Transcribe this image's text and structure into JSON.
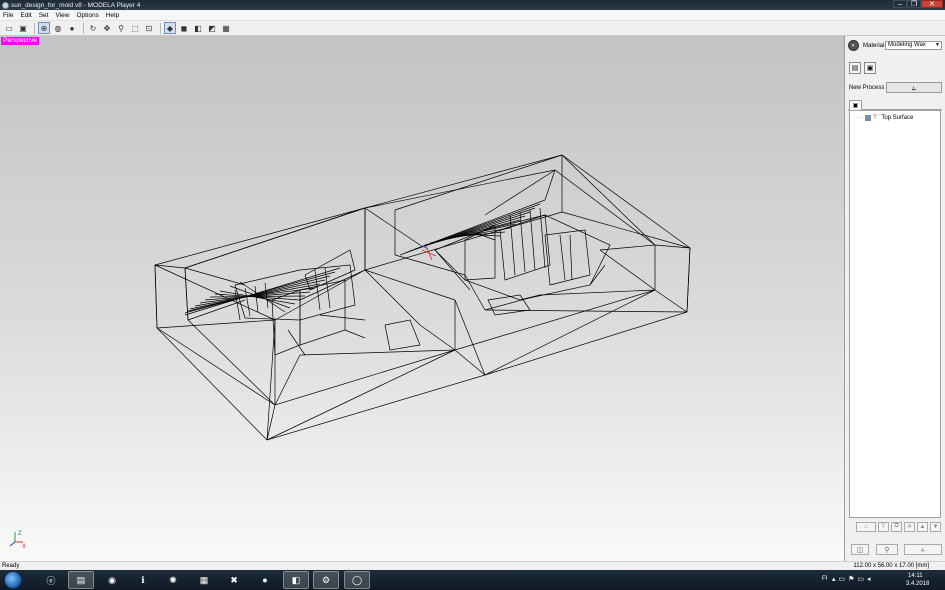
{
  "window": {
    "title": "sun_design_for_mold v8 - MODELA Player 4",
    "controls": [
      "–",
      "❐",
      "✕"
    ]
  },
  "menu": [
    "File",
    "Edit",
    "Set",
    "View",
    "Options",
    "Help"
  ],
  "toolbar": {
    "icons": [
      "open-icon",
      "save-icon",
      "view-all-icon",
      "view-globe-icon",
      "view-sphere-icon",
      "rotate-icon",
      "pan-icon",
      "zoom-icon",
      "zoom-window-icon",
      "zoom-fit-icon",
      "iso-view-icon",
      "front-view-icon",
      "side-view-icon",
      "top-view-icon",
      "grid-view-icon"
    ]
  },
  "viewport": {
    "view_label": "Perspective",
    "axis_labels": {
      "z": "Z",
      "x": "X"
    }
  },
  "panel": {
    "material_label": "Material",
    "material_value": "Modeling Wax",
    "new_process_label": "New Process",
    "tree": [
      {
        "label": "Top Surface"
      }
    ]
  },
  "status": {
    "left": "Ready",
    "right": "112.00 x 56.00 x 17.00 [mm]"
  },
  "taskbar": {
    "items": [
      "ie-icon",
      "explorer-icon",
      "ccleaner-icon",
      "info-icon",
      "app-icon",
      "sonos-icon",
      "xampp-icon",
      "firefox-icon",
      "roland-icon",
      "settings-icon",
      "modela-icon"
    ],
    "lang": "FI",
    "time": "14:11",
    "date": "3.4.2018"
  }
}
